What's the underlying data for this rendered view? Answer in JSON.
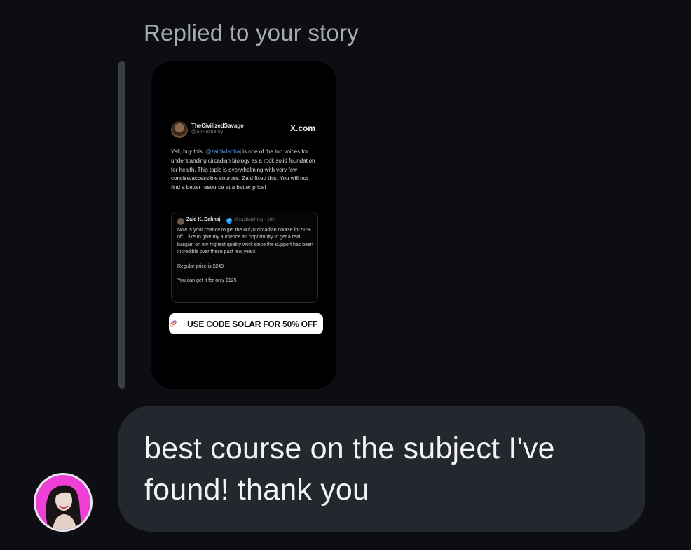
{
  "reply": {
    "label": "Replied to your story"
  },
  "story": {
    "author_name": "TheCivilizedSavage",
    "author_handle": "@SirPalmeroy",
    "site": "X.com",
    "body_before_mention": "Yall, buy this. ",
    "mention": "@zaidkdahhaj",
    "body_after_mention": " is one of the top voices for understanding circadian biology as a rock solid foundation for health. This topic is overwhelming with very few concise/accessible sources. Zaid fixed this. You will not find a better resource at a better price!",
    "quote": {
      "name": "Zaid K. Dahhaj",
      "meta": "@zaidkdahhaj · 18h",
      "paragraph1": "Now is your chance to get the 80/20 circadian course for 50% off. I like to give my audience an opportunity to get a real bargain on my highest quality work since the support has been incredible over these past few years",
      "paragraph2": "Regular price is $249",
      "paragraph3": "You can get it for only $125"
    },
    "cta_label": "USE CODE SOLAR FOR 50% OFF",
    "cta_icon": "link-icon"
  },
  "message": {
    "text": "best course on the subject I've found! thank you"
  },
  "colors": {
    "background": "#0c0e13",
    "bubble": "#25272e",
    "mention": "#4a9cf0",
    "avatar_bg": "#ee3fd6"
  }
}
